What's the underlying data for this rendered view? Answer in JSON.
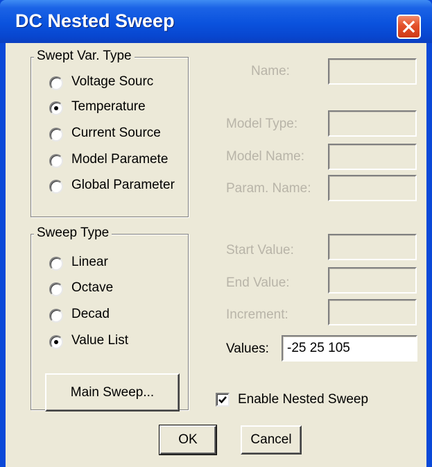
{
  "window": {
    "title": "DC Nested Sweep"
  },
  "swept_var_type": {
    "label": "Swept Var. Type",
    "options": [
      {
        "label": "Voltage Sourc",
        "checked": false
      },
      {
        "label": "Temperature",
        "checked": true
      },
      {
        "label": "Current Source",
        "checked": false
      },
      {
        "label": "Model Paramete",
        "checked": false
      },
      {
        "label": "Global Parameter",
        "checked": false
      }
    ]
  },
  "sweep_type": {
    "label": "Sweep Type",
    "options": [
      {
        "label": "Linear",
        "checked": false
      },
      {
        "label": "Octave",
        "checked": false
      },
      {
        "label": "Decad",
        "checked": false
      },
      {
        "label": "Value List",
        "checked": true
      }
    ]
  },
  "fields": {
    "name_label": "Name:",
    "model_type_label": "Model Type:",
    "model_name_label": "Model Name:",
    "param_name_label": "Param. Name:",
    "start_value_label": "Start Value:",
    "end_value_label": "End Value:",
    "increment_label": "Increment:",
    "values_label": "Values:",
    "values_value": "-25 25 105"
  },
  "buttons": {
    "main_sweep": "Main Sweep...",
    "ok": "OK",
    "cancel": "Cancel"
  },
  "enable_nested_sweep": {
    "label": "Enable Nested Sweep",
    "checked": true
  }
}
